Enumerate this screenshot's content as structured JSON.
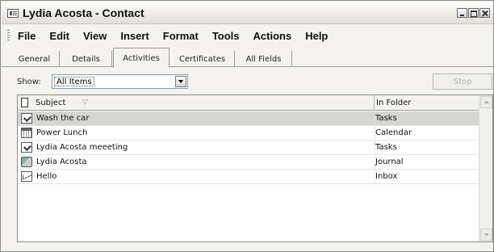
{
  "window": {
    "title": "Lydia Acosta - Contact"
  },
  "menu": [
    "File",
    "Edit",
    "View",
    "Insert",
    "Format",
    "Tools",
    "Actions",
    "Help"
  ],
  "tabs": [
    {
      "label": "General",
      "active": false
    },
    {
      "label": "Details",
      "active": false
    },
    {
      "label": "Activities",
      "active": true
    },
    {
      "label": "Certificates",
      "active": false
    },
    {
      "label": "All Fields",
      "active": false
    }
  ],
  "filter": {
    "label": "Show:",
    "selected": "All Items",
    "stop_label": "Stop"
  },
  "list": {
    "columns": {
      "subject": "Subject",
      "folder": "In Folder"
    },
    "rows": [
      {
        "icon": "task-icon",
        "subject": "Wash the car",
        "folder": "Tasks",
        "selected": true
      },
      {
        "icon": "calendar-icon",
        "subject": "Power Lunch",
        "folder": "Calendar",
        "selected": false
      },
      {
        "icon": "task-icon",
        "subject": "Lydia Acosta meeeting",
        "folder": "Tasks",
        "selected": false
      },
      {
        "icon": "journal-icon",
        "subject": "Lydia Acosta",
        "folder": "Journal",
        "selected": false
      },
      {
        "icon": "mail-icon",
        "subject": "Hello",
        "folder": "Inbox",
        "selected": false
      }
    ]
  }
}
